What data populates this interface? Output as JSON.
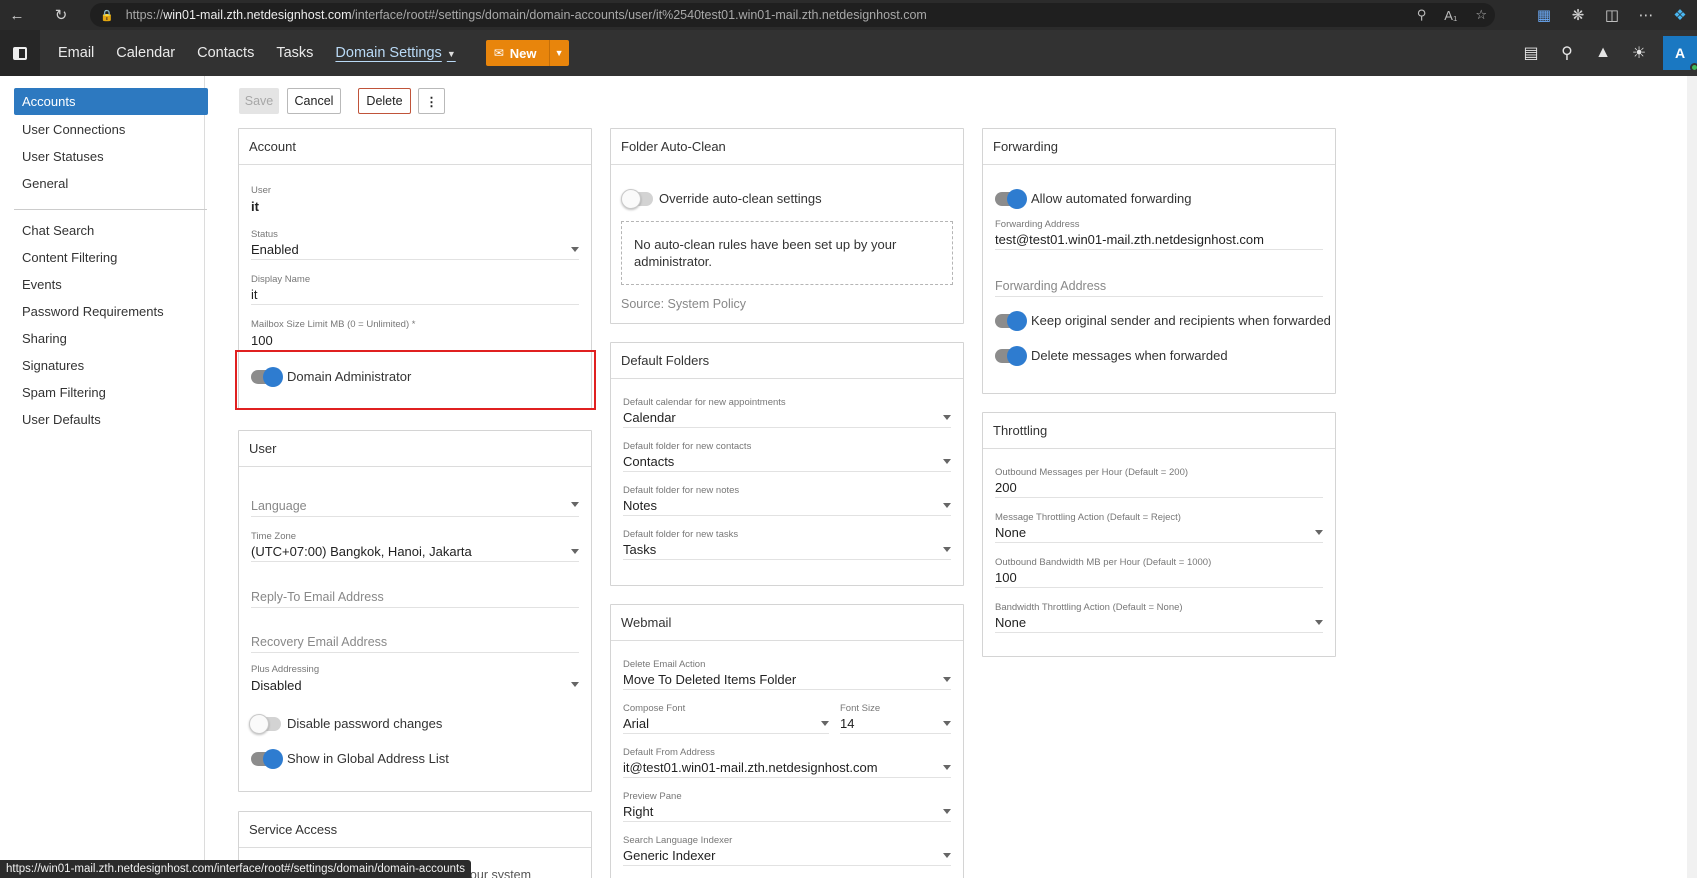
{
  "browser": {
    "url_prefix": "https://",
    "url_host": "win01-mail.zth.netdesignhost.com",
    "url_path": "/interface/root#/settings/domain/domain-accounts/user/it%2540test01.win01-mail.zth.netdesignhost.com",
    "status_link": "https://win01-mail.zth.netdesignhost.com/interface/root#/settings/domain/domain-accounts"
  },
  "header": {
    "nav": [
      "Email",
      "Calendar",
      "Contacts",
      "Tasks"
    ],
    "active_nav": "Domain Settings",
    "new_label": "New",
    "avatar": "A"
  },
  "sidebar": {
    "group1": [
      "Accounts",
      "User Connections",
      "User Statuses",
      "General"
    ],
    "group2": [
      "Chat Search",
      "Content Filtering",
      "Events",
      "Password Requirements",
      "Sharing",
      "Signatures",
      "Spam Filtering",
      "User Defaults"
    ]
  },
  "toolbar": {
    "save": "Save",
    "cancel": "Cancel",
    "delete": "Delete",
    "more": "⋮"
  },
  "account": {
    "title": "Account",
    "user_label": "User",
    "user_value": "it",
    "status_label": "Status",
    "status_value": "Enabled",
    "display_label": "Display Name",
    "display_value": "it",
    "mailbox_label": "Mailbox Size Limit MB (0 = Unlimited) *",
    "mailbox_value": "100",
    "domain_admin": "Domain Administrator"
  },
  "user": {
    "title": "User",
    "language_placeholder": "Language",
    "timezone_label": "Time Zone",
    "timezone_value": "(UTC+07:00) Bangkok, Hanoi, Jakarta",
    "reply_to_placeholder": "Reply-To Email Address",
    "recovery_placeholder": "Recovery Email Address",
    "plus_label": "Plus Addressing",
    "plus_value": "Disabled",
    "disable_pw": "Disable password changes",
    "show_gal": "Show in Global Address List"
  },
  "service": {
    "title": "Service Access",
    "partial_text": "by your system"
  },
  "autoclean": {
    "title": "Folder Auto-Clean",
    "override": "Override auto-clean settings",
    "info": "No auto-clean rules have been set up by your administrator.",
    "source": "Source: System Policy"
  },
  "folders": {
    "title": "Default Folders",
    "items": [
      {
        "label": "Default calendar for new appointments",
        "value": "Calendar"
      },
      {
        "label": "Default folder for new contacts",
        "value": "Contacts"
      },
      {
        "label": "Default folder for new notes",
        "value": "Notes"
      },
      {
        "label": "Default folder for new tasks",
        "value": "Tasks"
      }
    ]
  },
  "webmail": {
    "title": "Webmail",
    "delete_label": "Delete Email Action",
    "delete_value": "Move To Deleted Items Folder",
    "font_label": "Compose Font",
    "font_value": "Arial",
    "size_label": "Font Size",
    "size_value": "14",
    "from_label": "Default From Address",
    "from_value": "it@test01.win01-mail.zth.netdesignhost.com",
    "preview_label": "Preview Pane",
    "preview_value": "Right",
    "indexer_label": "Search Language Indexer",
    "indexer_value": "Generic Indexer"
  },
  "forwarding": {
    "title": "Forwarding",
    "allow": "Allow automated forwarding",
    "addr_label": "Forwarding Address",
    "addr_value": "test@test01.win01-mail.zth.netdesignhost.com",
    "addr_placeholder": "Forwarding Address",
    "keep": "Keep original sender and recipients when forwarded",
    "delete": "Delete messages when forwarded"
  },
  "throttling": {
    "title": "Throttling",
    "out_msg_label": "Outbound Messages per Hour (Default = 200)",
    "out_msg_value": "200",
    "msg_action_label": "Message Throttling Action (Default = Reject)",
    "msg_action_value": "None",
    "bw_label": "Outbound Bandwidth MB per Hour (Default = 1000)",
    "bw_value": "100",
    "bw_action_label": "Bandwidth Throttling Action (Default = None)",
    "bw_action_value": "None"
  }
}
